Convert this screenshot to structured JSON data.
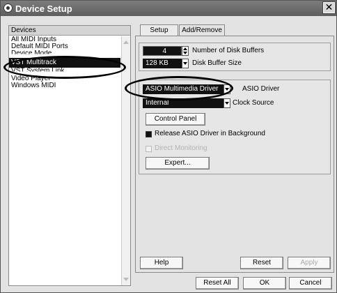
{
  "window": {
    "title": "Device Setup",
    "close_glyph": "✕"
  },
  "devices": {
    "header": "Devices",
    "items": [
      "All MIDI Inputs",
      "Default MIDI Ports",
      "Device Mode",
      "VST Multitrack",
      "VST System Link",
      "Video Player",
      "Windows MIDI"
    ],
    "selected": "VST Multitrack"
  },
  "tabs": {
    "setup": "Setup",
    "add_remove": "Add/Remove"
  },
  "setup": {
    "disk_buffers_value": "4",
    "disk_buffers_label": "Number of Disk Buffers",
    "disk_buffer_size_value": "128 KB",
    "disk_buffer_size_label": "Disk Buffer Size",
    "asio_driver_value": "ASIO Multimedia Driver",
    "asio_driver_label": "ASIO Driver",
    "clock_source_value": "Internal",
    "clock_source_label": "Clock Source",
    "control_panel": "Control Panel",
    "release_asio_label": "Release ASIO Driver in Background",
    "release_asio_checked": true,
    "direct_monitoring_label": "Direct Monitoring",
    "direct_monitoring_checked": false,
    "expert": "Expert..."
  },
  "buttons": {
    "help": "Help",
    "reset": "Reset",
    "apply": "Apply",
    "reset_all": "Reset All",
    "ok": "OK",
    "cancel": "Cancel"
  }
}
